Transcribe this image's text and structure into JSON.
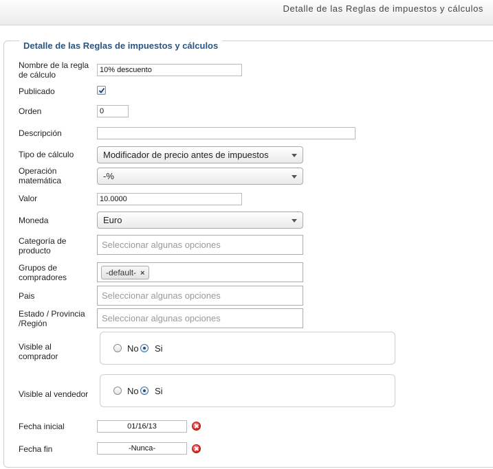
{
  "header": {
    "title": "Detalle de las Reglas de impuestos y cálculos"
  },
  "panel": {
    "legend": "Detalle de las Reglas de impuestos y cálculos"
  },
  "fields": {
    "rule_name": {
      "label": "Nombre de la regla de cálculo",
      "value": "10% descuento"
    },
    "published": {
      "label": "Publicado",
      "checked": true
    },
    "order": {
      "label": "Orden",
      "value": "0"
    },
    "description": {
      "label": "Descripción",
      "value": ""
    },
    "calc_type": {
      "label": "Tipo de cálculo",
      "value": "Modificador de precio antes de impuestos"
    },
    "math_op": {
      "label": "Operación matemática",
      "value": "-%"
    },
    "value": {
      "label": "Valor",
      "value": "10.0000"
    },
    "currency": {
      "label": "Moneda",
      "value": "Euro"
    },
    "product_category": {
      "label": "Categoría de producto",
      "placeholder": "Seleccionar algunas opciones"
    },
    "shopper_groups": {
      "label": "Grupos de compradores",
      "chips": [
        "-default-"
      ],
      "chip_remove": "×"
    },
    "country": {
      "label": "Pais",
      "placeholder": "Seleccionar algunas opciones"
    },
    "state": {
      "label": "Estado / Provincia /Región",
      "placeholder": "Seleccionar algunas opciones"
    },
    "visible_shopper": {
      "label": "Visible al comprador",
      "no": "No",
      "si": "Si",
      "selected": "si"
    },
    "visible_vendor": {
      "label": "Visible al vendedor",
      "no": "No",
      "si": "Si",
      "selected": "si"
    },
    "start_date": {
      "label": "Fecha inicial",
      "value": "01/16/13"
    },
    "end_date": {
      "label": "Fecha fin",
      "value": "-Nunca-"
    }
  },
  "icons": {
    "checkbox": "checkmark-icon",
    "delete": "delete-icon",
    "dropdown": "chevron-down-icon"
  },
  "colors": {
    "legend": "#2a5580",
    "delete": "#d42020"
  }
}
